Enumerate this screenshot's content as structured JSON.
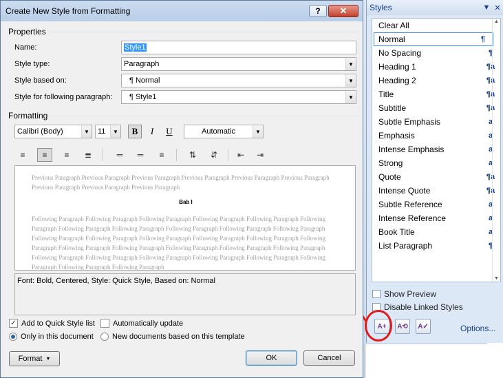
{
  "dialog": {
    "title": "Create New Style from Formatting",
    "properties_header": "Properties",
    "name_label": "Name:",
    "name_value": "Style1",
    "style_type_label": "Style type:",
    "style_type_value": "Paragraph",
    "based_on_label": "Style based on:",
    "based_on_value": "¶ Normal",
    "following_label": "Style for following paragraph:",
    "following_value": "¶ Style1",
    "formatting_header": "Formatting",
    "font_name": "Calibri (Body)",
    "font_size": "11",
    "bold_label": "B",
    "italic_label": "I",
    "underline_label": "U",
    "color_value": "Automatic",
    "preview_previous": "Previous Paragraph Previous Paragraph Previous Paragraph Previous Paragraph Previous Paragraph Previous Paragraph Previous Paragraph Previous Paragraph Previous Paragraph",
    "preview_sample": "Bab I",
    "preview_following": "Following Paragraph Following Paragraph Following Paragraph Following Paragraph Following Paragraph Following Paragraph Following Paragraph Following Paragraph Following Paragraph Following Paragraph Following Paragraph Following Paragraph Following Paragraph Following Paragraph Following Paragraph Following Paragraph Following Paragraph Following Paragraph Following Paragraph Following Paragraph Following Paragraph Following Paragraph Following Paragraph Following Paragraph Following Paragraph Following Paragraph Following Paragraph Following Paragraph Following Paragraph Following Paragraph",
    "description": "Font: Bold, Centered, Style: Quick Style, Based on: Normal",
    "add_quick_style": "Add to Quick Style list",
    "auto_update": "Automatically update",
    "only_this_doc": "Only in this document",
    "new_docs": "New documents based on this template",
    "format_button": "Format",
    "ok_button": "OK",
    "cancel_button": "Cancel"
  },
  "styles_pane": {
    "title": "Styles",
    "items": [
      {
        "name": "Clear All",
        "glyph": ""
      },
      {
        "name": "Normal",
        "glyph": "¶"
      },
      {
        "name": "No Spacing",
        "glyph": "¶"
      },
      {
        "name": "Heading 1",
        "glyph": "¶a"
      },
      {
        "name": "Heading 2",
        "glyph": "¶a"
      },
      {
        "name": "Title",
        "glyph": "¶a"
      },
      {
        "name": "Subtitle",
        "glyph": "¶a"
      },
      {
        "name": "Subtle Emphasis",
        "glyph": "a"
      },
      {
        "name": "Emphasis",
        "glyph": "a"
      },
      {
        "name": "Intense Emphasis",
        "glyph": "a"
      },
      {
        "name": "Strong",
        "glyph": "a"
      },
      {
        "name": "Quote",
        "glyph": "¶a"
      },
      {
        "name": "Intense Quote",
        "glyph": "¶a"
      },
      {
        "name": "Subtle Reference",
        "glyph": "a"
      },
      {
        "name": "Intense Reference",
        "glyph": "a"
      },
      {
        "name": "Book Title",
        "glyph": "a"
      },
      {
        "name": "List Paragraph",
        "glyph": "¶"
      }
    ],
    "selected_index": 1,
    "show_preview": "Show Preview",
    "disable_linked": "Disable Linked Styles",
    "options_link": "Options..."
  },
  "colors": {
    "annotation": "#e01b1b",
    "selection": "#3399ff",
    "link": "#15428b"
  }
}
